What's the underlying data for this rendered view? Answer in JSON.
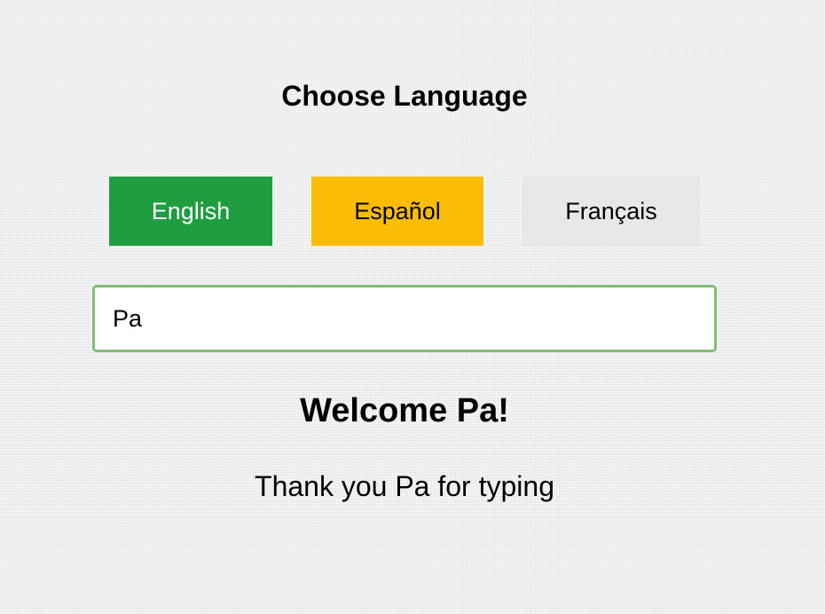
{
  "heading": "Choose Language",
  "language_buttons": [
    {
      "label": "English",
      "color": "#1e9e3e"
    },
    {
      "label": "Español",
      "color": "#fbbc05"
    },
    {
      "label": "Français",
      "color": "#e8e8e8"
    }
  ],
  "name_input": {
    "value": "Pa",
    "border_color": "#7fbf74"
  },
  "welcome_text": "Welcome Pa!",
  "thanks_text": "Thank you Pa for typing"
}
